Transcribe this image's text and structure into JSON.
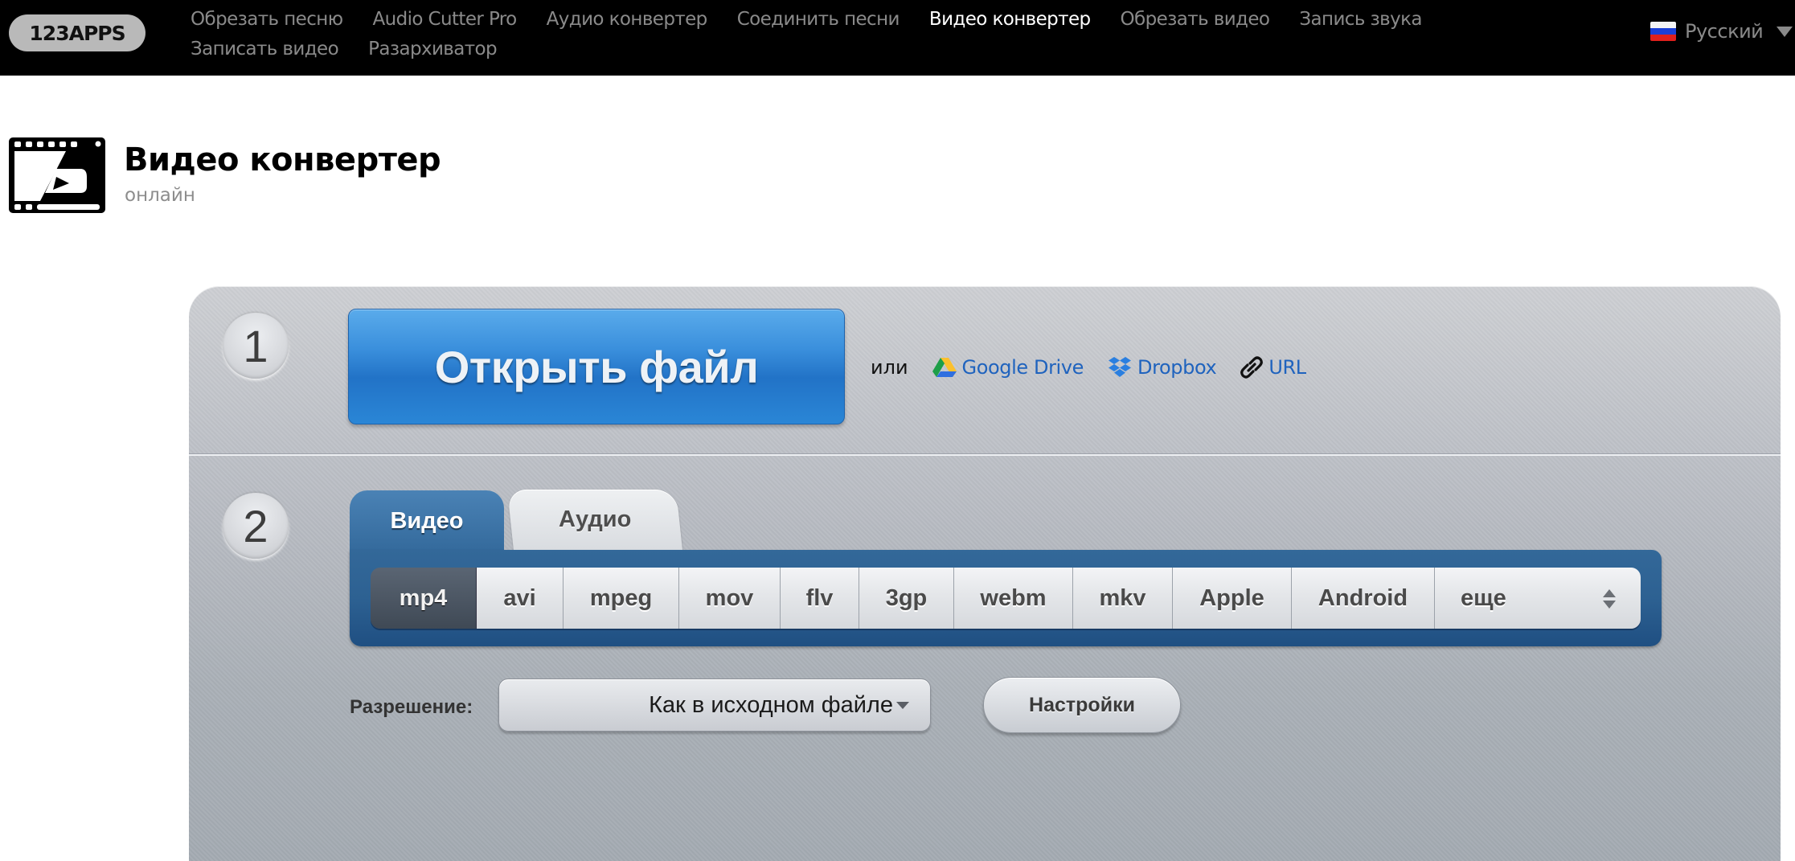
{
  "topbar": {
    "logo": "123APPS",
    "nav": [
      {
        "label": "Обрезать песню",
        "active": false
      },
      {
        "label": "Audio Cutter Pro",
        "active": false
      },
      {
        "label": "Аудио конвертер",
        "active": false
      },
      {
        "label": "Соединить песни",
        "active": false
      },
      {
        "label": "Видео конвертер",
        "active": true
      },
      {
        "label": "Обрезать видео",
        "active": false
      },
      {
        "label": "Запись звука",
        "active": false
      },
      {
        "label": "Записать видео",
        "active": false
      },
      {
        "label": "Разархиватор",
        "active": false
      }
    ],
    "language": {
      "label": "Русский",
      "flag_colors": [
        "#ffffff",
        "#1c3fd6",
        "#e0201c"
      ]
    }
  },
  "header": {
    "title": "Видео конвертер",
    "subtitle": "онлайн",
    "icon": "film-play-icon"
  },
  "step1": {
    "number": "1",
    "open_button": "Открыть файл",
    "or_label": "или",
    "sources": [
      {
        "label": "Google Drive",
        "icon": "google-drive-icon"
      },
      {
        "label": "Dropbox",
        "icon": "dropbox-icon"
      },
      {
        "label": "URL",
        "icon": "link-icon"
      }
    ]
  },
  "step2": {
    "number": "2",
    "tabs": [
      {
        "label": "Видео",
        "active": true
      },
      {
        "label": "Аудио",
        "active": false
      }
    ],
    "formats": [
      {
        "label": "mp4",
        "active": true
      },
      {
        "label": "avi",
        "active": false
      },
      {
        "label": "mpeg",
        "active": false
      },
      {
        "label": "mov",
        "active": false
      },
      {
        "label": "flv",
        "active": false
      },
      {
        "label": "3gp",
        "active": false
      },
      {
        "label": "webm",
        "active": false
      },
      {
        "label": "mkv",
        "active": false
      },
      {
        "label": "Apple",
        "active": false
      },
      {
        "label": "Android",
        "active": false
      }
    ],
    "more_label": "еще",
    "resolution_label": "Разрешение:",
    "resolution_value": "Как в исходном файле",
    "settings_button": "Настройки"
  },
  "colors": {
    "accent_blue": "#2a7fd2",
    "link_blue": "#1f63be",
    "format_bar": "#2d6192",
    "topbar": "#000000"
  }
}
